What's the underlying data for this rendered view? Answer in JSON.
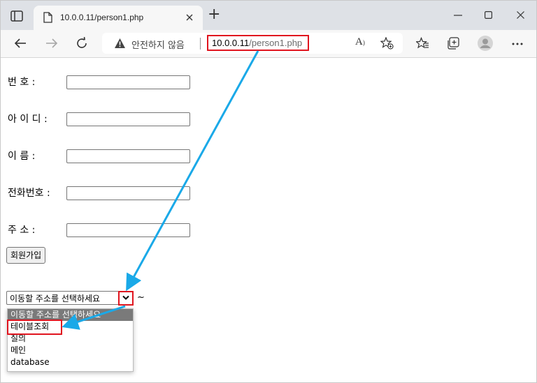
{
  "browser": {
    "tab_title": "10.0.0.11/person1.php",
    "new_tab_symbol": "+",
    "security_text": "안전하지 않음",
    "url_host": "10.0.0.11",
    "url_path": "/person1.php",
    "window_controls": [
      "minimize-icon",
      "maximize-icon",
      "close-icon"
    ],
    "toolbar_icons": [
      "back-icon",
      "forward-icon",
      "refresh-icon",
      "warning-icon",
      "read-aloud-icon",
      "add-favorite-icon",
      "favorites-icon",
      "collections-icon",
      "profile-icon",
      "more-icon"
    ]
  },
  "form": {
    "fields": [
      {
        "label": "번 호 :",
        "value": ""
      },
      {
        "label": "아 이 디 :",
        "value": ""
      },
      {
        "label": "이 름 :",
        "value": ""
      },
      {
        "label": "전화번호 :",
        "value": ""
      },
      {
        "label": "주 소 :",
        "value": ""
      }
    ],
    "submit_label": "회원가입"
  },
  "navigator": {
    "selected": "이동할 주소를 선택하세요",
    "suffix": "~",
    "options": [
      "이동할 주소를 선택하세요",
      "테이블조회",
      "질의",
      "메인",
      "database"
    ]
  },
  "annotations": {
    "highlight_color": "#e0141e",
    "arrow_color": "#1aa9e8"
  }
}
